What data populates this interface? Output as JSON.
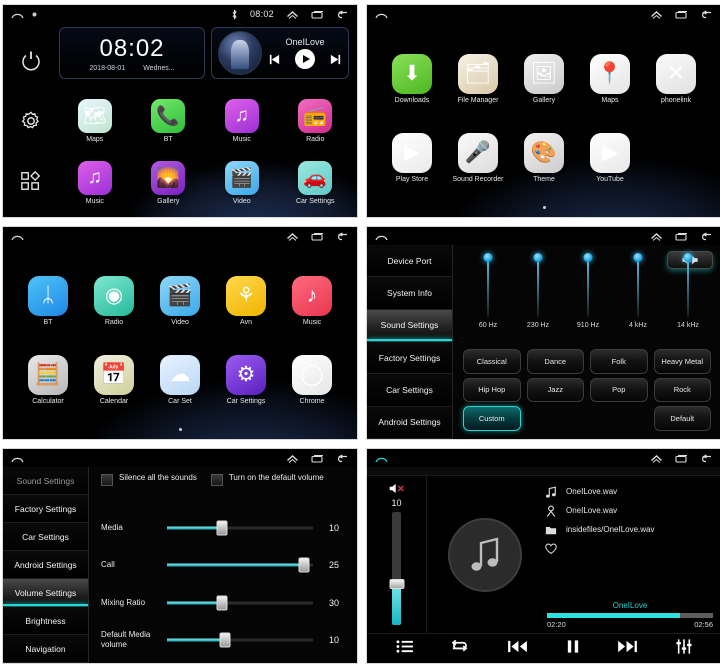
{
  "statusbar": {
    "time": "08:02",
    "icons": [
      "home-icon",
      "bluetooth-icon",
      "chevron-up-icon",
      "recents-icon",
      "back-icon"
    ]
  },
  "home": {
    "rail": [
      "power-icon",
      "gear-icon",
      "apps-icon"
    ],
    "clock": {
      "time": "08:02",
      "date": "2018-08-01",
      "weekday": "Wednes..."
    },
    "nowplaying": {
      "title": "OneILove",
      "prev": "prev-icon",
      "play": "play-icon",
      "next": "next-icon"
    },
    "apps": [
      {
        "label": "Maps",
        "icon": "maps-icon",
        "glyph": "🗺",
        "c1": "#e8f6ff",
        "c2": "#bfe4d0"
      },
      {
        "label": "BT",
        "icon": "phone-icon",
        "glyph": "📞",
        "c1": "#72e86a",
        "c2": "#2fbf3a"
      },
      {
        "label": "Music",
        "icon": "music-icon",
        "glyph": "♫",
        "c1": "#e060e8",
        "c2": "#9b2fd6"
      },
      {
        "label": "Radio",
        "icon": "radio-icon",
        "glyph": "📻",
        "c1": "#f06ec0",
        "c2": "#d22a8e"
      },
      {
        "label": "Music",
        "icon": "music-icon",
        "glyph": "♫",
        "c1": "#e060e8",
        "c2": "#9b2fd6"
      },
      {
        "label": "Gallery",
        "icon": "gallery-icon",
        "glyph": "🌄",
        "c1": "#b35ae0",
        "c2": "#7a1fc0"
      },
      {
        "label": "Video",
        "icon": "video-icon",
        "glyph": "🎬",
        "c1": "#8fd8f8",
        "c2": "#3aa8e8"
      },
      {
        "label": "Car Settings",
        "icon": "car-settings-icon",
        "glyph": "🚗",
        "c1": "#9be8e0",
        "c2": "#5ec8c8"
      }
    ]
  },
  "drawer1": {
    "apps": [
      {
        "label": "Downloads",
        "icon": "downloads-icon",
        "glyph": "⬇",
        "c1": "#8ae05a",
        "c2": "#4cb81f"
      },
      {
        "label": "File Manager",
        "icon": "file-manager-icon",
        "glyph": "🗂",
        "c1": "#f7f2e6",
        "c2": "#d8c9a8"
      },
      {
        "label": "Gallery",
        "icon": "gallery-icon",
        "glyph": "🖼",
        "c1": "#f0f0f0",
        "c2": "#c9c9c9"
      },
      {
        "label": "Maps",
        "icon": "maps-icon",
        "glyph": "📍",
        "c1": "#ffffff",
        "c2": "#e4e4e4"
      },
      {
        "label": "phonelink",
        "icon": "phonelink-icon",
        "glyph": "✕",
        "c1": "#fbfbfb",
        "c2": "#e0e0e0"
      },
      {
        "label": "Play Store",
        "icon": "play-store-icon",
        "glyph": "▶",
        "c1": "#ffffff",
        "c2": "#eaeaea"
      },
      {
        "label": "Sound Recorder",
        "icon": "sound-recorder-icon",
        "glyph": "🎤",
        "c1": "#fafafa",
        "c2": "#dcdcdc"
      },
      {
        "label": "Theme",
        "icon": "theme-icon",
        "glyph": "🎨",
        "c1": "#f2f2f2",
        "c2": "#cccccc"
      },
      {
        "label": "YouTube",
        "icon": "youtube-icon",
        "glyph": "▶",
        "c1": "#ffffff",
        "c2": "#e8e8e8"
      }
    ],
    "page_dots": 1
  },
  "drawer2": {
    "apps": [
      {
        "label": "BT",
        "icon": "bluetooth-icon",
        "glyph": "ᛦ",
        "c1": "#4fc3f7",
        "c2": "#1e88e5"
      },
      {
        "label": "Radio",
        "icon": "radio-icon",
        "glyph": "◉",
        "c1": "#7ee8d0",
        "c2": "#26b89a"
      },
      {
        "label": "Video",
        "icon": "video-icon",
        "glyph": "🎬",
        "c1": "#8fd8f8",
        "c2": "#3aa8e8"
      },
      {
        "label": "Avn",
        "icon": "avn-icon",
        "glyph": "⚘",
        "c1": "#ffd84d",
        "c2": "#f0b400"
      },
      {
        "label": "Music",
        "icon": "music-icon",
        "glyph": "♪",
        "c1": "#ff6b7e",
        "c2": "#e8364f"
      },
      {
        "label": "Calculator",
        "icon": "calculator-icon",
        "glyph": "🧮",
        "c1": "#e8e8e8",
        "c2": "#b8b8b8"
      },
      {
        "label": "Calendar",
        "icon": "calendar-icon",
        "glyph": "📅",
        "c1": "#f0f0e0",
        "c2": "#cfcf9a"
      },
      {
        "label": "Car Set",
        "icon": "car-set-icon",
        "glyph": "☁",
        "c1": "#e8f2ff",
        "c2": "#b9d8f5"
      },
      {
        "label": "Car Settings",
        "icon": "car-settings-icon",
        "glyph": "⚙",
        "c1": "#9b5cf0",
        "c2": "#5a1fc0"
      },
      {
        "label": "Chrome",
        "icon": "chrome-icon",
        "glyph": "◯",
        "c1": "#ffffff",
        "c2": "#e6e6e6"
      }
    ],
    "page_dots": 1
  },
  "sound_settings": {
    "menu": [
      {
        "label": "Device Port",
        "selected": false
      },
      {
        "label": "System Info",
        "selected": false
      },
      {
        "label": "Sound Settings",
        "selected": true
      },
      {
        "label": "Factory Settings",
        "selected": false
      },
      {
        "label": "Car Settings",
        "selected": false
      },
      {
        "label": "Android Settings",
        "selected": false
      }
    ],
    "speaker_button": "speaker-balance-icon",
    "equalizer": {
      "bands": [
        {
          "label": "60 Hz",
          "value": 100
        },
        {
          "label": "230 Hz",
          "value": 100
        },
        {
          "label": "910 Hz",
          "value": 100
        },
        {
          "label": "4 kHz",
          "value": 100
        },
        {
          "label": "14 kHz",
          "value": 100
        }
      ]
    },
    "presets": [
      {
        "label": "Classical",
        "selected": false
      },
      {
        "label": "Dance",
        "selected": false
      },
      {
        "label": "Folk",
        "selected": false
      },
      {
        "label": "Heavy Metal",
        "selected": false
      },
      {
        "label": "Hip Hop",
        "selected": false
      },
      {
        "label": "Jazz",
        "selected": false
      },
      {
        "label": "Pop",
        "selected": false
      },
      {
        "label": "Rock",
        "selected": false
      },
      {
        "label": "Custom",
        "selected": true
      },
      {
        "label": "",
        "selected": false
      },
      {
        "label": "",
        "selected": false
      },
      {
        "label": "Default",
        "selected": false
      }
    ]
  },
  "volume_settings": {
    "menu": [
      {
        "label": "Sound Settings",
        "selected": false,
        "cut": true
      },
      {
        "label": "Factory Settings",
        "selected": false
      },
      {
        "label": "Car Settings",
        "selected": false
      },
      {
        "label": "Android Settings",
        "selected": false
      },
      {
        "label": "Volume Settings",
        "selected": true
      },
      {
        "label": "Brightness",
        "selected": false
      },
      {
        "label": "Navigation",
        "selected": false
      }
    ],
    "checkboxes": [
      {
        "label": "Silence all the sounds",
        "checked": false
      },
      {
        "label": "Turn on the default volume",
        "checked": false
      }
    ],
    "sliders": [
      {
        "label": "Media",
        "value": "10",
        "percent": 38
      },
      {
        "label": "Call",
        "value": "25",
        "percent": 94
      },
      {
        "label": "Mixing Ratio",
        "value": "30",
        "percent": 38
      },
      {
        "label": "Default Media volume",
        "value": "10",
        "percent": 40
      }
    ]
  },
  "player": {
    "mute_icon": "mute-icon",
    "volume_value": "10",
    "disc_icon": "music-note-icon",
    "meta": [
      {
        "icon": "music-note-icon",
        "text": "OneILove.wav"
      },
      {
        "icon": "artist-icon",
        "text": "OneILove.wav"
      },
      {
        "icon": "folder-icon",
        "text": "insidefiles/OneILove.wav"
      },
      {
        "icon": "heart-icon",
        "text": ""
      }
    ],
    "progress": {
      "title": "OneILove",
      "elapsed": "02:20",
      "total": "02:56",
      "percent": 80
    },
    "controls": [
      "playlist-icon",
      "repeat-icon",
      "previous-icon",
      "pause-icon",
      "next-icon",
      "equalizer-icon"
    ],
    "accent": "#2fe0e0"
  }
}
